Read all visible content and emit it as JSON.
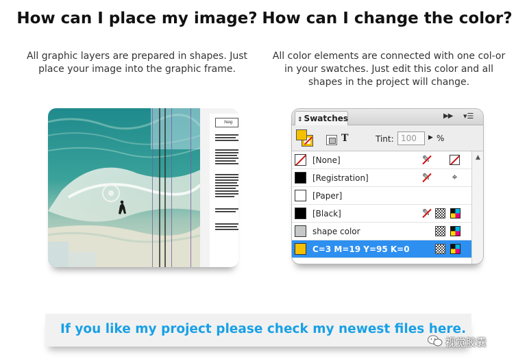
{
  "left": {
    "title": "How can I place my image?",
    "description": "All graphic layers are prepared in shapes. Just place your image into the graphic frame.",
    "doc_heading": "Neig"
  },
  "right": {
    "title": "How can I change the color?",
    "description": "All color elements are connected with one col-or in your swatches. Just edit this color and all shapes in the project will change."
  },
  "swatches_panel": {
    "tab_label": "Swatches",
    "format_text_icon": "T",
    "tint_label": "Tint:",
    "tint_value": "100",
    "percent_symbol": "%",
    "fill_color": "#f5c000",
    "selected_color": "#2d8ff0",
    "items": [
      {
        "name": "[None]",
        "color": "none",
        "icons": [
          "no-edit-icon",
          "none-icon"
        ]
      },
      {
        "name": "[Registration]",
        "color": "#000000",
        "icons": [
          "no-edit-icon",
          "registration-icon"
        ]
      },
      {
        "name": "[Paper]",
        "color": "#ffffff",
        "icons": []
      },
      {
        "name": "[Black]",
        "color": "#000000",
        "icons": [
          "no-edit-icon",
          "process-icon",
          "cmyk-icon"
        ]
      },
      {
        "name": "shape color",
        "color": "#c6c8c8",
        "icons": [
          "process-icon",
          "cmyk-icon"
        ]
      },
      {
        "name": "C=3 M=19 Y=95 K=0",
        "color": "#f5c000",
        "icons": [
          "process-icon",
          "cmyk-icon"
        ],
        "selected": true
      }
    ]
  },
  "banner": {
    "text": "If you like my project please check my newest files here.",
    "color": "#19a0e6"
  },
  "watermark": {
    "text": "视觉胶囊"
  }
}
